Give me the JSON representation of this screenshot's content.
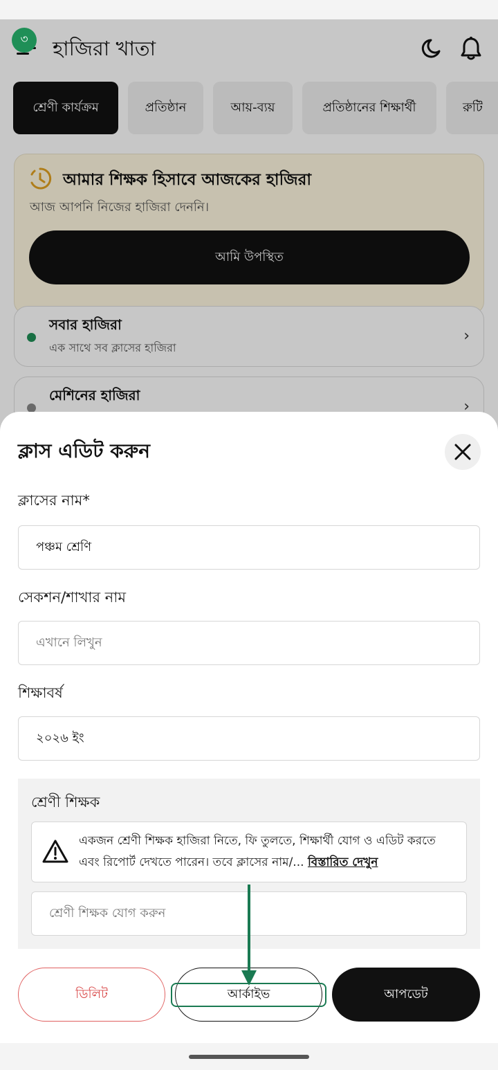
{
  "header": {
    "notification_count": "৩",
    "app_title": "হাজিরা খাতা"
  },
  "tabs": [
    {
      "label": "শ্রেণী কার্যক্রম",
      "active": true
    },
    {
      "label": "প্রতিষ্ঠান",
      "active": false
    },
    {
      "label": "আয়-ব্যয়",
      "active": false
    },
    {
      "label": "প্রতিষ্ঠানের শিক্ষার্থী",
      "active": false
    },
    {
      "label": "রুটি",
      "active": false
    }
  ],
  "attendance_card": {
    "title": "আমার শিক্ষক হিসাবে আজকের হাজিরা",
    "subtitle": "আজ আপনি নিজের হাজিরা দেননি।",
    "button_label": "আমি উপস্থিত"
  },
  "attendance_list": [
    {
      "title": "সবার হাজিরা",
      "subtitle": "এক সাথে সব ক্লাসের হাজিরা",
      "dot_color": "#1f8f57"
    },
    {
      "title": "মেশিনের হাজিরা",
      "subtitle": "",
      "dot_color": "#888888"
    }
  ],
  "sheet": {
    "title": "ক্লাস এডিট করুন",
    "class_name_label": "ক্লাসের নাম*",
    "class_name_value": "পঞ্চম শ্রেণি",
    "section_label": "সেকশন/শাখার নাম",
    "section_placeholder": "এখানে লিখুন",
    "year_label": "শিক্ষাবর্ষ",
    "year_value": "২০২৬ ইং",
    "teacher_label": "শ্রেণী শিক্ষক",
    "teacher_notice": "একজন শ্রেণী শিক্ষক হাজিরা নিতে, ফি তুলতে, শিক্ষার্থী যোগ ও এডিট করতে এবং রিপোর্ট দেখতে পারেন। তবে ক্লাসের নাম/...",
    "teacher_notice_link": "বিস্তারিত দেখুন",
    "teacher_placeholder": "শ্রেণী শিক্ষক যোগ করুন",
    "delete_label": "ডিলিট",
    "archive_label": "আর্কাইভ",
    "update_label": "আপডেট"
  },
  "colors": {
    "accent_green": "#1f8f57",
    "delete_red": "#d84343",
    "dark": "#111111"
  }
}
